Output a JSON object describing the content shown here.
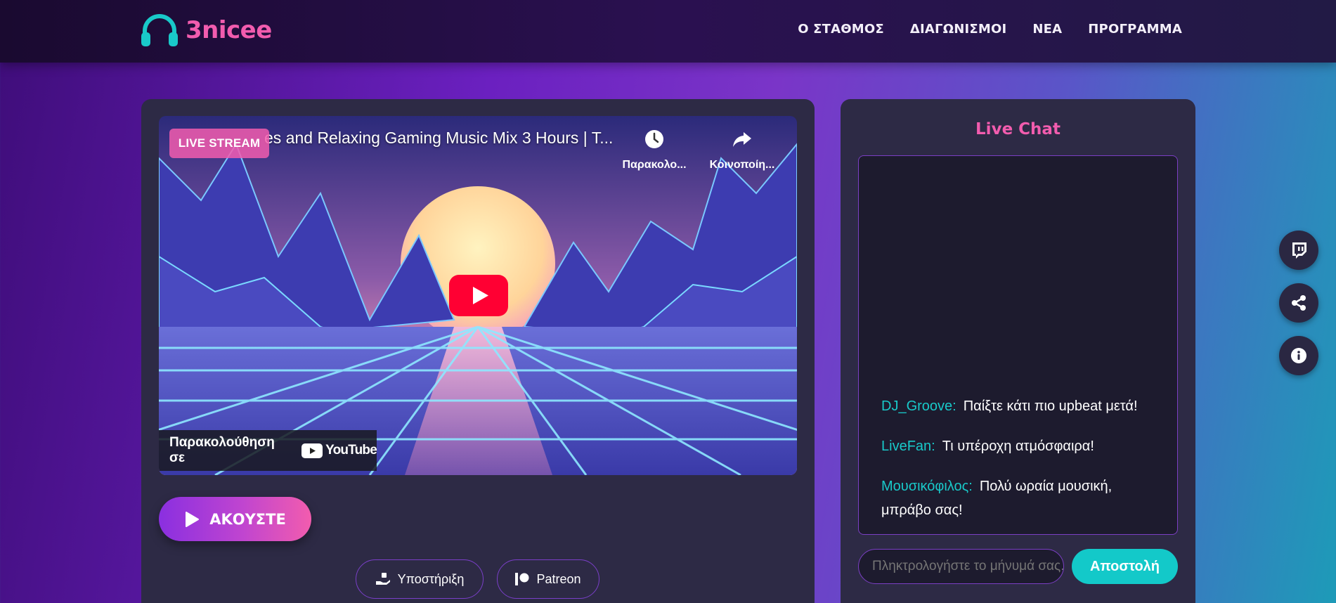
{
  "brand": {
    "name": "3nicee",
    "logo_icon": "headphones-icon",
    "accent": "#f25cae",
    "logo_icon_color": "#19c9c9"
  },
  "nav": [
    {
      "label": "Ο ΣΤΑΘΜΟΣ"
    },
    {
      "label": "ΔΙΑΓΩΝΙΣΜΟΙ"
    },
    {
      "label": "ΝΕΑ"
    },
    {
      "label": "ΠΡΟΓΡΑΜΜΑ"
    }
  ],
  "player": {
    "badge": "LIVE STREAM",
    "video_title": "es and Relaxing Gaming Music Mix 3 Hours | T...",
    "actions": [
      {
        "label": "Παρακολο...",
        "icon": "clock-icon"
      },
      {
        "label": "Κοινοποίη...",
        "icon": "share-arrow-icon"
      }
    ],
    "watch_on": "Παρακολούθηση σε",
    "watch_on_brand": "YouTube",
    "play_icon": "youtube-play-icon"
  },
  "listen_button": {
    "label": "ΑΚΟΥΣΤΕ",
    "icon": "play-icon"
  },
  "support_links": [
    {
      "label": "Υποστήριξη",
      "icon": "donate-hand-icon"
    },
    {
      "label": "Patreon",
      "icon": "patreon-icon"
    }
  ],
  "chat": {
    "title": "Live Chat",
    "messages": [
      {
        "user": "DJ_Groove:",
        "text": "Παίξτε κάτι πιο upbeat μετά!"
      },
      {
        "user": "LiveFan:",
        "text": "Τι υπέροχη ατμόσφαιρα!"
      },
      {
        "user": "Μουσικόφιλος:",
        "text": "Πολύ ωραία μουσική, μπράβο σας!"
      }
    ],
    "input_placeholder": "Πληκτρολογήστε το μήνυμά σας...",
    "send_label": "Αποστολή",
    "user_color": "#19c9c9"
  },
  "side_buttons": [
    {
      "icon": "twitch-icon"
    },
    {
      "icon": "share-icon"
    },
    {
      "icon": "info-icon"
    }
  ]
}
